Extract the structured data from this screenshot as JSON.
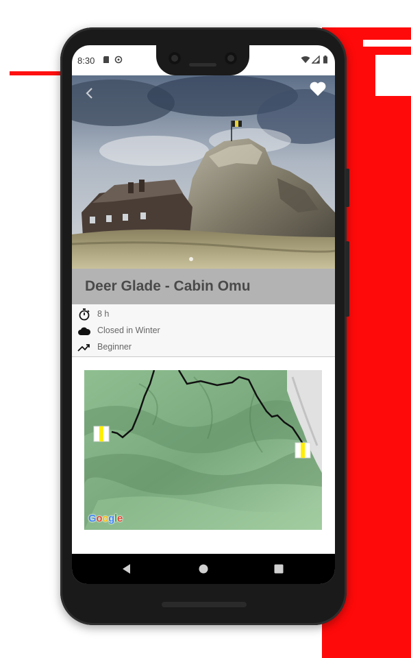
{
  "status_bar": {
    "time": "8:30",
    "left_icons": [
      "sd-card-icon",
      "sync-icon"
    ],
    "right_icons": [
      "wifi-icon",
      "signal-icon",
      "battery-icon"
    ]
  },
  "hero": {
    "back_icon": "chevron-left-icon",
    "favorite_icon": "heart-icon"
  },
  "trail": {
    "title": "Deer Glade - Cabin Omu",
    "details": [
      {
        "icon": "stopwatch-icon",
        "label": "8 h"
      },
      {
        "icon": "cloud-icon",
        "label": "Closed in Winter"
      },
      {
        "icon": "trending-up-icon",
        "label": "Beginner"
      }
    ]
  },
  "map": {
    "attribution": "Google",
    "markers": [
      "start-marker",
      "end-marker"
    ]
  },
  "navigation": {
    "buttons": [
      "back-triangle-icon",
      "home-circle-icon",
      "recents-square-icon"
    ]
  },
  "colors": {
    "title_band": "#b3b3b3",
    "title_text": "#4a4a4a",
    "route_line": "#111111",
    "marker_yellow": "#ffee00",
    "background_accent": "#ff0000"
  }
}
